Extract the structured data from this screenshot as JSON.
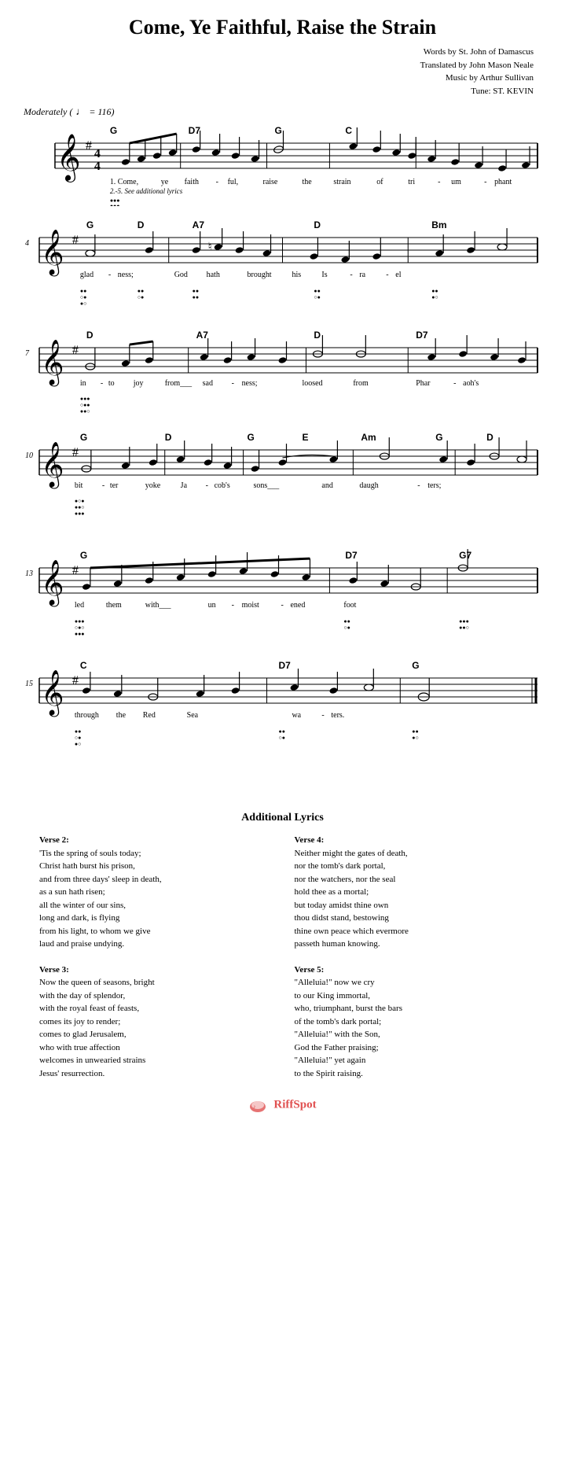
{
  "title": "Come, Ye Faithful, Raise the Strain",
  "attribution": {
    "line1": "Words by St. John of Damascus",
    "line2": "Translated by John Mason Neale",
    "line3": "Music by Arthur Sullivan",
    "line4": "Tune: ST. KEVIN"
  },
  "tempo": {
    "marking": "Moderately",
    "bpm_symbol": "♩",
    "bpm_value": "= 116"
  },
  "staves": [
    {
      "id": "staff1",
      "measure_start": 1,
      "chords": [
        "G",
        "",
        "",
        "D7",
        "G",
        "",
        "C",
        ""
      ],
      "lyric1": "1. Come,  ye  faith - ful,  raise  the  strain  of  tri - um - phant",
      "lyric2": "2.-5. See additional lyrics"
    },
    {
      "id": "staff2",
      "measure_start": 4,
      "chords": [
        "G",
        "D",
        "A7",
        "",
        "",
        "D",
        "",
        "Bm"
      ],
      "lyric1": "glad - ness;  God  hath  brought  his  Is - ra - el"
    },
    {
      "id": "staff3",
      "measure_start": 7,
      "chords": [
        "D",
        "A7",
        "",
        "D",
        "",
        "D7",
        ""
      ],
      "lyric1": "in - to  joy  from___  sad - ness;  loosed  from  Phar - aoh's"
    },
    {
      "id": "staff4",
      "measure_start": 10,
      "chords": [
        "G",
        "D",
        "G",
        "E",
        "",
        "Am",
        "G",
        "D"
      ],
      "lyric1": "bit - ter  yoke  Ja - cob's  sons___  and  daugh - ters;"
    },
    {
      "id": "staff5",
      "measure_start": 13,
      "chords": [
        "G",
        "",
        "",
        "",
        "",
        "D7",
        "G7"
      ],
      "lyric1": "led  them  with___  un - moist - ened  foot"
    },
    {
      "id": "staff6",
      "measure_start": 15,
      "chords": [
        "C",
        "",
        "D7",
        "G"
      ],
      "lyric1": "through  the  Red  Sea  wa - ters."
    }
  ],
  "additional_lyrics": {
    "title": "Additional Lyrics",
    "verses": [
      {
        "number": "Verse 2:",
        "lines": [
          "'Tis the spring of souls today;",
          "Christ hath burst his prison,",
          "and from three days' sleep in death,",
          "as a sun hath risen;",
          "all the winter of our sins,",
          "long and dark, is flying",
          "from his light, to whom we give",
          "laud and praise undying."
        ]
      },
      {
        "number": "Verse 4:",
        "lines": [
          "Neither might the gates of death,",
          "nor the tomb's dark portal,",
          "nor the watchers, nor the seal",
          "hold thee as a mortal;",
          "but today amidst thine own",
          "thou didst stand, bestowing",
          "thine own peace which evermore",
          "passeth human knowing."
        ]
      },
      {
        "number": "Verse 3:",
        "lines": [
          "Now the queen of seasons, bright",
          "with the day of splendor,",
          "with the royal feast of feasts,",
          "comes its joy to render;",
          "comes to glad Jerusalem,",
          "who with true affection",
          "welcomes in unwearied strains",
          "Jesus' resurrection."
        ]
      },
      {
        "number": "Verse 5:",
        "lines": [
          "\"Alleluia!\" now we cry",
          "to our King immortal,",
          "who, triumphant, burst the bars",
          "of the tomb's dark portal;",
          "\"Alleluia!\" with the Son,",
          "God the Father praising;",
          "\"Alleluia!\" yet again",
          "to the Spirit raising."
        ]
      }
    ]
  },
  "footer": {
    "brand": "RiffSpot"
  }
}
